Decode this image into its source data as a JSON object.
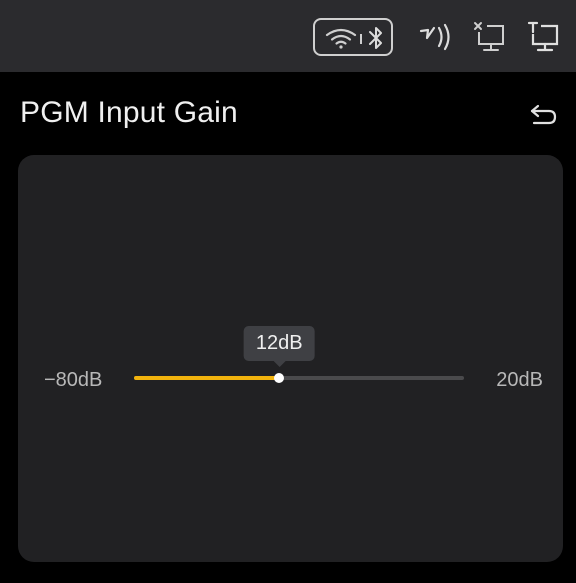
{
  "status_bar": {
    "icons": [
      "wifi-icon",
      "bluetooth-icon",
      "nfc-icon",
      "monitor-disconnected-icon",
      "monitor-icon"
    ]
  },
  "header": {
    "title": "PGM Input Gain",
    "back_icon": "back-icon"
  },
  "slider": {
    "min_label": "−80dB",
    "max_label": "20dB",
    "min": -80,
    "max": 20,
    "value": 12,
    "value_label": "12dB",
    "fill_fraction": 0.44,
    "accent_color": "#f2b30d",
    "track_color": "#4a4a4c"
  }
}
